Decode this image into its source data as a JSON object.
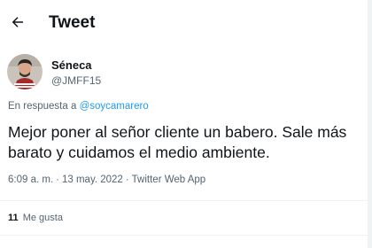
{
  "header": {
    "title": "Tweet",
    "back_icon": "arrow-left-icon"
  },
  "author": {
    "name": "Séneca",
    "handle": "@JMFF15"
  },
  "reply": {
    "prefix": "En respuesta a ",
    "mention": "@soycamarero"
  },
  "tweet": {
    "text": "Mejor poner al señor cliente un babero. Sale más barato y cuidamos el medio ambiente."
  },
  "meta": {
    "time": "6:09 a. m.",
    "separator1": "·",
    "date": "13 may. 2022",
    "separator2": "·",
    "source": "Twitter Web App"
  },
  "stats": {
    "likes_count": "11",
    "likes_label": "Me gusta"
  },
  "colors": {
    "accent": "#1d9bf0",
    "text": "#0f1419",
    "secondary": "#536471",
    "border": "#eff3f4"
  }
}
